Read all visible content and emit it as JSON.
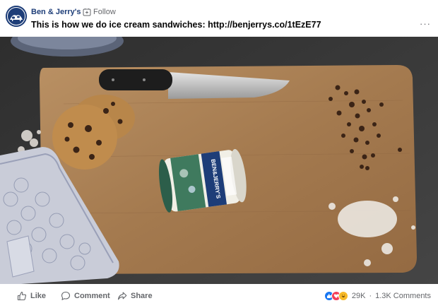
{
  "post": {
    "page_name": "Ben & Jerry's",
    "separator": "·",
    "follow_label": "Follow",
    "text": "This is how we do ice cream sandwiches: http://benjerrys.co/1tEzE77",
    "more_icon": "more-horizontal-icon"
  },
  "video": {
    "pint_label": "BEN&JERRY'S"
  },
  "actions": {
    "like_label": "Like",
    "comment_label": "Comment",
    "share_label": "Share"
  },
  "engagement": {
    "reaction_icons": [
      "like-reaction-icon",
      "love-reaction-icon",
      "haha-reaction-icon"
    ],
    "reactions_count": "29K",
    "separator": "·",
    "comments_count": "1.3K Comments"
  },
  "colors": {
    "brand_blue": "#1d3d78",
    "like_blue": "#1877f2",
    "love_red": "#f33e58",
    "haha_yellow": "#f7b928",
    "secondary_text": "#65676b"
  }
}
